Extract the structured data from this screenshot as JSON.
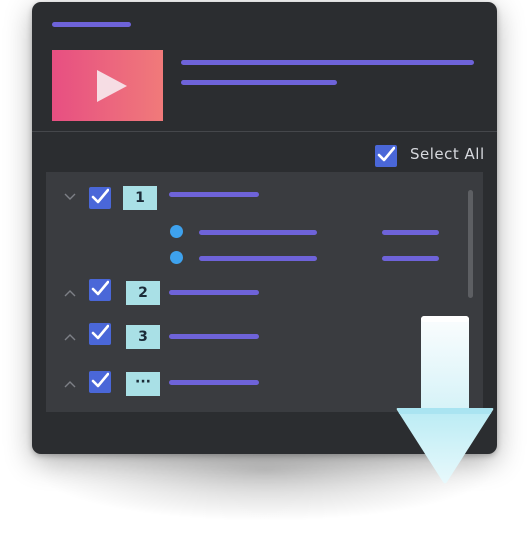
{
  "header": {
    "thumbnail_icon": "play-icon"
  },
  "selection": {
    "select_all_label": "Select All",
    "select_all_checked": true
  },
  "tree": {
    "groups": [
      {
        "label": "1",
        "expanded": true,
        "checked": true,
        "chevron_icon": "chevron-down-icon"
      },
      {
        "label": "2",
        "expanded": false,
        "checked": true,
        "chevron_icon": "chevron-up-icon"
      },
      {
        "label": "3",
        "expanded": false,
        "checked": true,
        "chevron_icon": "chevron-up-icon"
      },
      {
        "label": "···",
        "expanded": false,
        "checked": true,
        "chevron_icon": "chevron-up-icon"
      }
    ],
    "sub_items_count_group_1": 2
  },
  "overlay": {
    "icon": "download-arrow-icon"
  },
  "colors": {
    "window_bg": "#2b2d30",
    "panel_bg": "#3a3c40",
    "placeholder_line": "#6e63d9",
    "checkbox": "#4a67d8",
    "number_badge": "#a9e0e6",
    "bullet": "#3ea2ee",
    "thumbnail_gradient_start": "#e74f82",
    "thumbnail_gradient_end": "#f07a7a",
    "download_arrow": "#dff6fb"
  }
}
